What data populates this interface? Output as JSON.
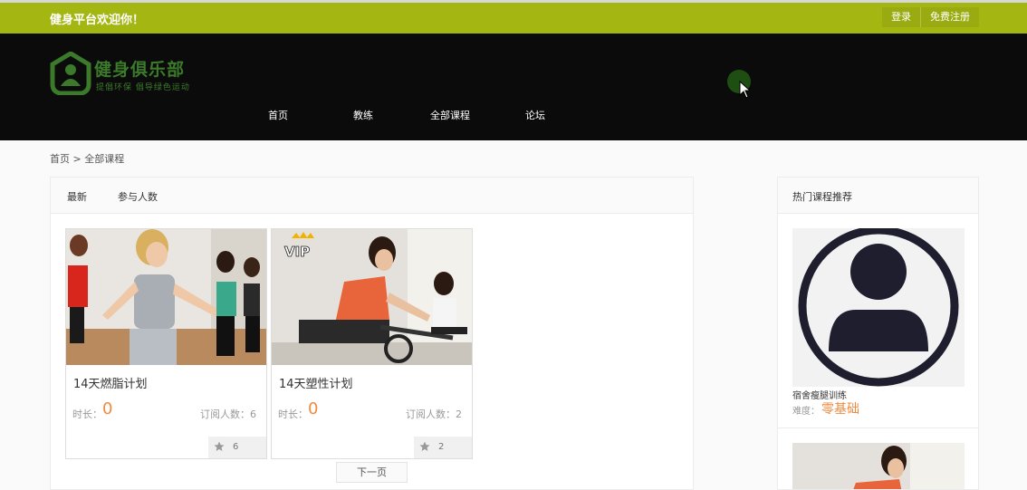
{
  "topbar": {
    "welcome": "健身平台欢迎你！",
    "login": "登录",
    "register": "免费注册"
  },
  "logo": {
    "name": "健身俱乐部",
    "slogan": "提倡环保 倡导绿色运动"
  },
  "nav": {
    "items": [
      "首页",
      "教练",
      "全部课程",
      "论坛"
    ]
  },
  "breadcrumb": {
    "home": "首页",
    "sep": " > ",
    "current": "全部课程"
  },
  "tabs": [
    "最新",
    "参与人数"
  ],
  "courses": [
    {
      "title": "14天燃脂计划",
      "duration_label": "时长：",
      "duration_value": "0",
      "subscribers": "订阅人数：6",
      "likes": "6",
      "vip": false
    },
    {
      "title": "14天塑性计划",
      "duration_label": "时长：",
      "duration_value": "0",
      "subscribers": "订阅人数：2",
      "likes": "2",
      "vip": true,
      "vip_label": "VIP"
    }
  ],
  "pagination": {
    "next": "下一页"
  },
  "sidebar": {
    "title": "热门课程推荐",
    "items": [
      {
        "title": "宿舍瘦腿训练",
        "difficulty_label": "难度：",
        "difficulty_value": "零基础"
      }
    ]
  },
  "colors": {
    "topbar": "#a3b612",
    "header": "#0b0b0b",
    "logo_green": "#3b7a2a",
    "accent_orange": "#f08a3e"
  }
}
